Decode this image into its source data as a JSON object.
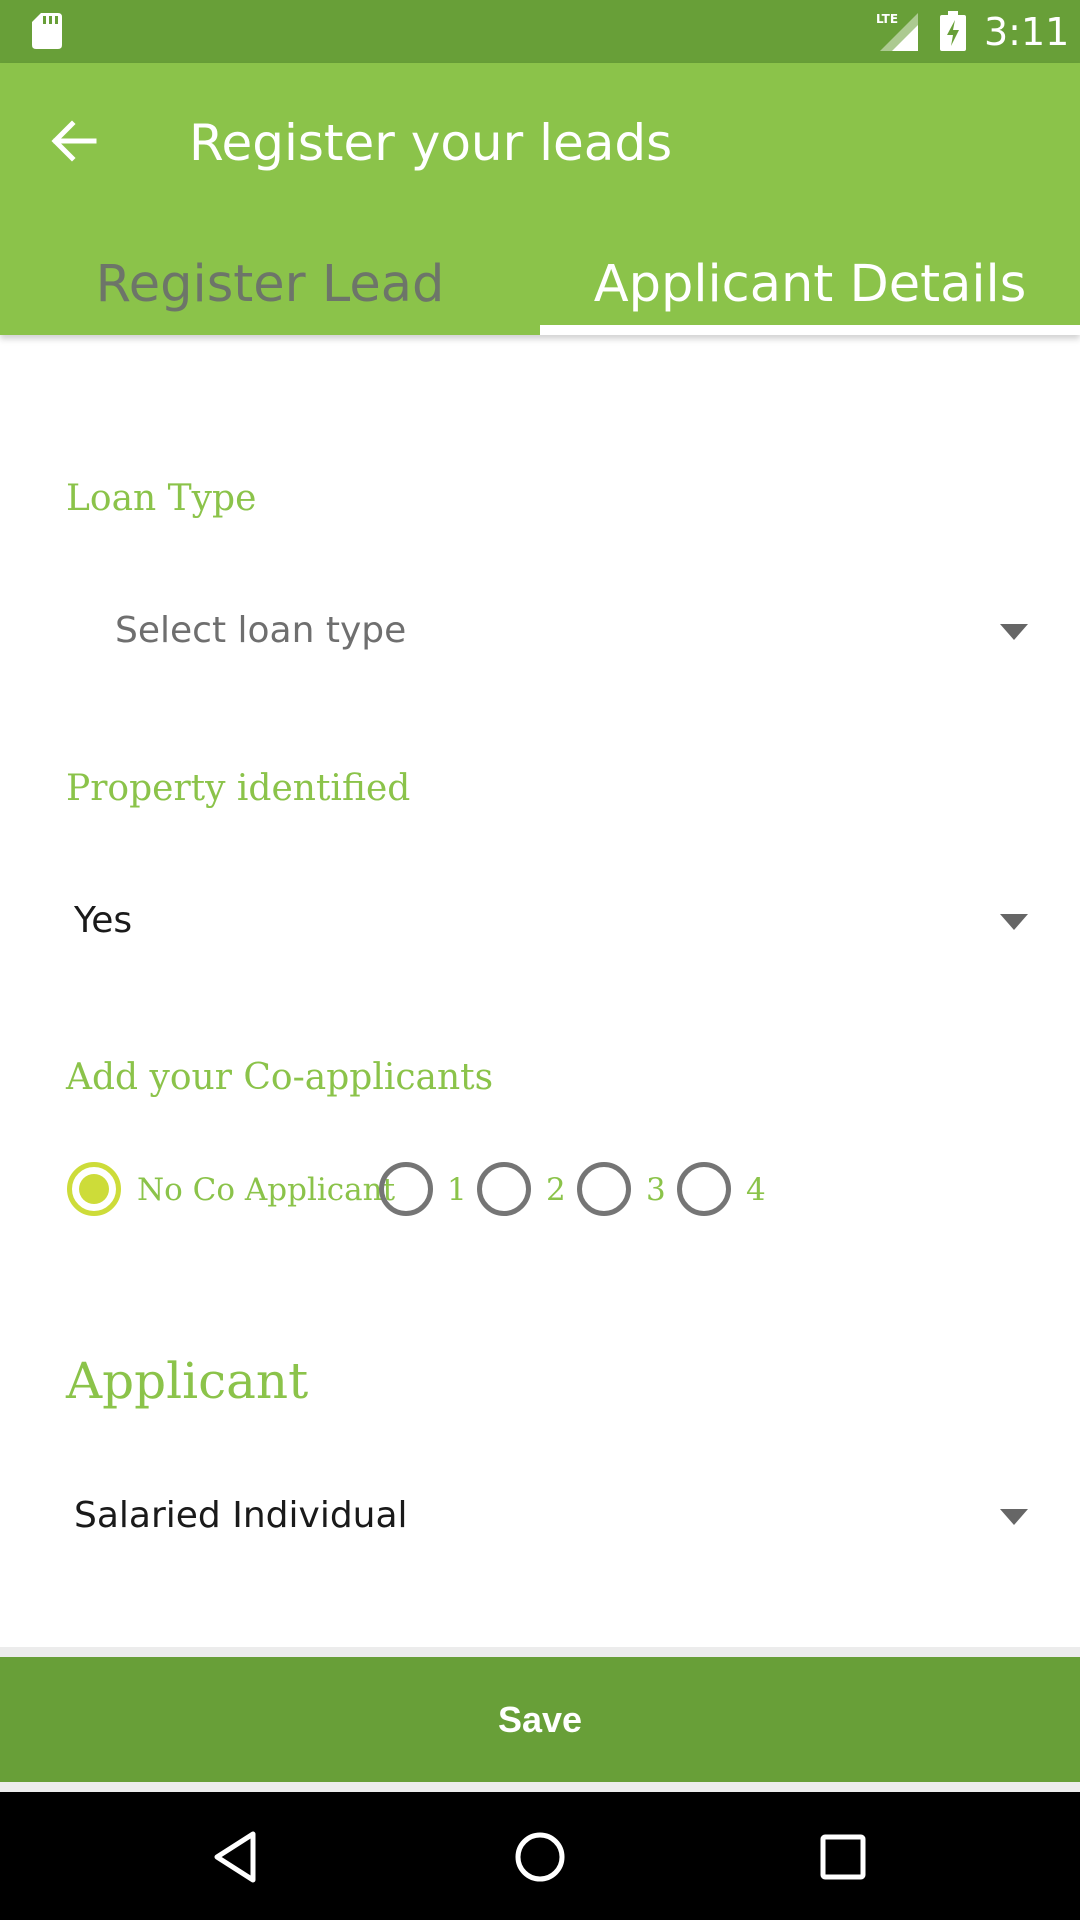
{
  "status_bar": {
    "time": "3:11",
    "network": "LTE",
    "icons": [
      "sd-card-icon",
      "lte-signal-icon",
      "battery-charging-icon"
    ]
  },
  "app_bar": {
    "title": "Register your leads",
    "back_icon": "arrow-back-icon",
    "tabs": [
      {
        "label": "Register Lead",
        "selected": false
      },
      {
        "label": "Applicant Details",
        "selected": true
      }
    ]
  },
  "form": {
    "loan_type": {
      "label": "Loan Type",
      "value": "Select loan type"
    },
    "property_identified": {
      "label": "Property identified",
      "value": "Yes"
    },
    "co_applicants": {
      "label": "Add your Co-applicants",
      "options": [
        {
          "label": "No Co Applicant",
          "selected": true
        },
        {
          "label": "1",
          "selected": false
        },
        {
          "label": "2",
          "selected": false
        },
        {
          "label": "3",
          "selected": false
        },
        {
          "label": "4",
          "selected": false
        }
      ]
    },
    "applicant": {
      "section_title": "Applicant",
      "value": "Salaried Individual"
    }
  },
  "save_button": {
    "label": "Save"
  },
  "nav_bar": {
    "icons": [
      "back-triangle-icon",
      "home-circle-icon",
      "recents-square-icon"
    ]
  },
  "colors": {
    "status_bar": "#689f38",
    "app_bar": "#8bc34a",
    "accent": "#8bc34a",
    "radio_selected": "#cddc39",
    "radio_unselected": "#757575",
    "save_button": "#689f38"
  }
}
